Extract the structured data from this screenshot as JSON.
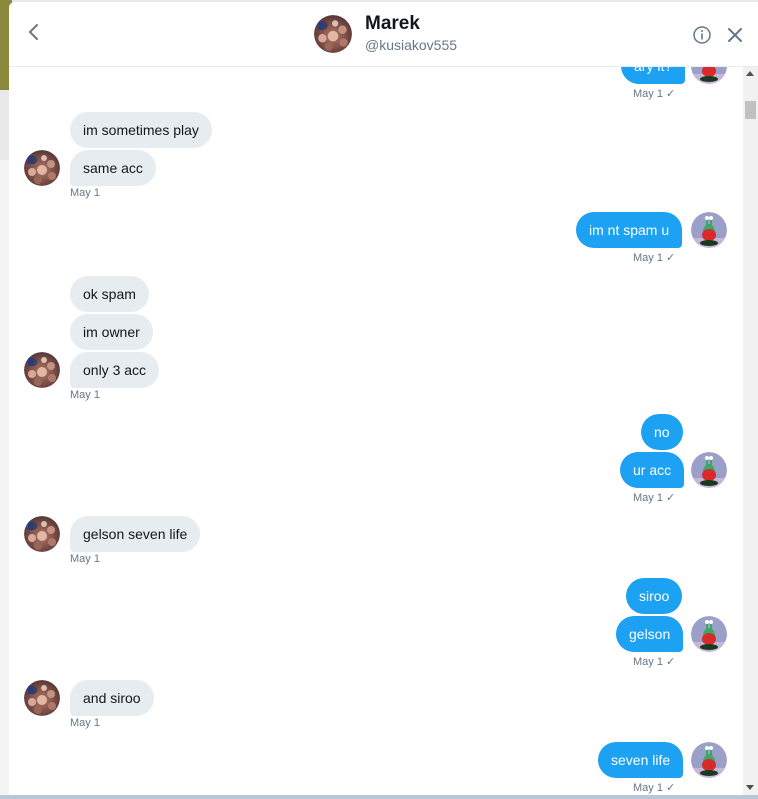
{
  "header": {
    "name": "Marek",
    "handle": "@kusiakov555",
    "back_icon": "chevron-left-icon",
    "info_icon": "info-icon",
    "close_icon": "close-icon"
  },
  "colors": {
    "outgoing_bubble": "#1da1f2",
    "incoming_bubble": "#e6ecf0",
    "meta_text": "#657786"
  },
  "messages": {
    "m0": {
      "text": "ary it?",
      "meta": "May 1 ✓"
    },
    "m1": {
      "text": "im sometimes play"
    },
    "m2": {
      "text": "same acc",
      "meta": "May 1"
    },
    "m3": {
      "text": "im nt spam u",
      "meta": "May 1 ✓"
    },
    "m4": {
      "text": "ok spam"
    },
    "m5": {
      "text": "im owner"
    },
    "m6": {
      "text": "only 3 acc",
      "meta": "May 1"
    },
    "m7": {
      "text": "no"
    },
    "m8": {
      "text": "ur acc",
      "meta": "May 1 ✓"
    },
    "m9": {
      "text": "gelson seven life",
      "meta": "May 1"
    },
    "m10": {
      "text": "siroo"
    },
    "m11": {
      "text": "gelson",
      "meta": "May 1 ✓"
    },
    "m12": {
      "text": "and siroo",
      "meta": "May 1"
    },
    "m13": {
      "text": "seven life",
      "meta": "May 1 ✓"
    }
  }
}
